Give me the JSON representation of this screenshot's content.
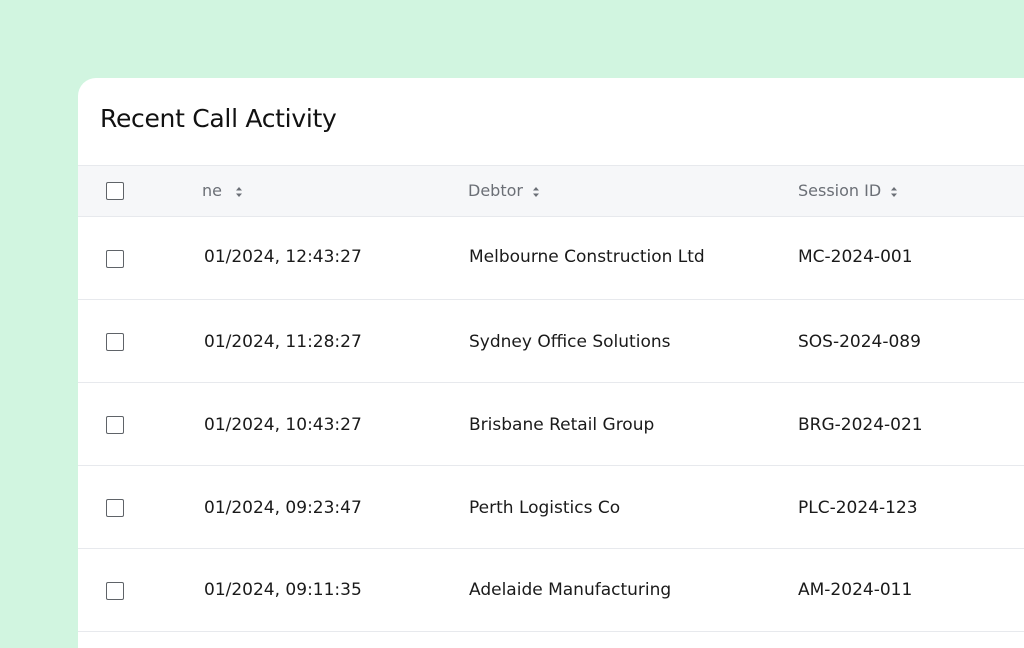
{
  "card": {
    "title": "Recent Call Activity"
  },
  "table": {
    "headers": {
      "time": "ne",
      "debtor": "Debtor",
      "session": "Session ID"
    },
    "rows": [
      {
        "time": "01/2024, 12:43:27",
        "debtor": "Melbourne Construction Ltd",
        "session": "MC-2024-001"
      },
      {
        "time": "01/2024, 11:28:27",
        "debtor": "Sydney Office Solutions",
        "session": "SOS-2024-089"
      },
      {
        "time": "01/2024, 10:43:27",
        "debtor": "Brisbane Retail Group",
        "session": "BRG-2024-021"
      },
      {
        "time": "01/2024, 09:23:47",
        "debtor": "Perth Logistics Co",
        "session": "PLC-2024-123"
      },
      {
        "time": "01/2024, 09:11:35",
        "debtor": "Adelaide Manufacturing",
        "session": "AM-2024-011"
      }
    ]
  },
  "colors": {
    "background": "#d1f5e0",
    "card": "#ffffff",
    "header_bg": "#f6f7f9",
    "header_text": "#6b6f76",
    "divider": "#e7e9ed"
  },
  "icons": {
    "sort": "sort-icon",
    "checkbox": "checkbox-icon"
  }
}
